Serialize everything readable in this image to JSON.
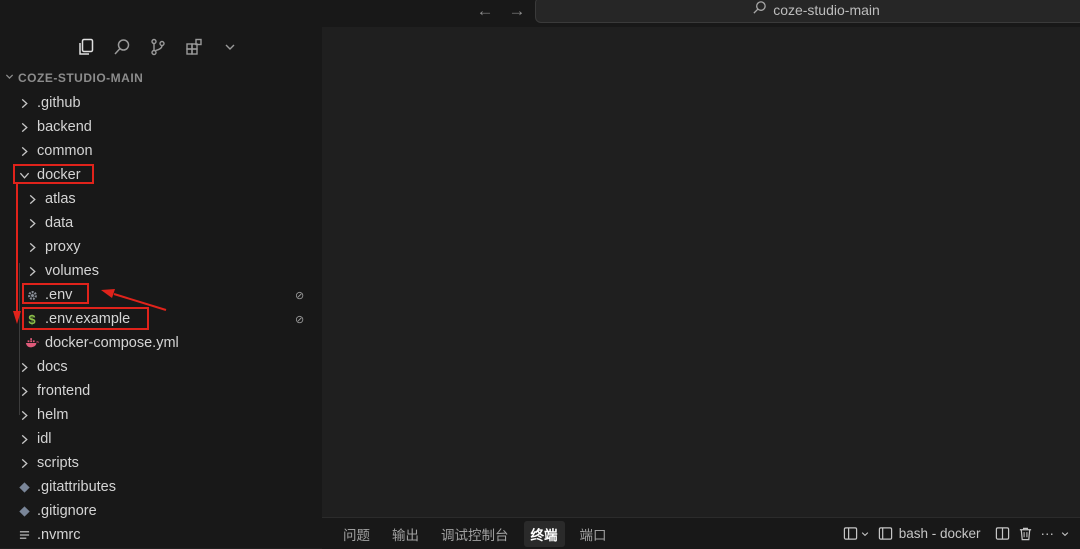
{
  "titlebar": {
    "back_icon": "arrow-left-icon",
    "forward_icon": "arrow-right-icon",
    "search_label": "coze-studio-main"
  },
  "activity_icons": [
    "explorer-icon",
    "search-icon",
    "source-control-icon",
    "extensions-icon",
    "chevron-down-icon"
  ],
  "explorer": {
    "root_label": "COZE-STUDIO-MAIN",
    "items": [
      {
        "label": ".github",
        "type": "folder",
        "expanded": false
      },
      {
        "label": "backend",
        "type": "folder",
        "expanded": false
      },
      {
        "label": "common",
        "type": "folder",
        "expanded": false
      },
      {
        "label": "docker",
        "type": "folder",
        "expanded": true
      },
      {
        "label": "atlas",
        "type": "folder",
        "expanded": false
      },
      {
        "label": "data",
        "type": "folder",
        "expanded": false
      },
      {
        "label": "proxy",
        "type": "folder",
        "expanded": false
      },
      {
        "label": "volumes",
        "type": "folder",
        "expanded": false
      },
      {
        "label": ".env",
        "type": "file",
        "icon": "gear-icon",
        "badge": "⊘"
      },
      {
        "label": ".env.example",
        "type": "file",
        "icon": "dollar-icon",
        "badge": "⊘"
      },
      {
        "label": "docker-compose.yml",
        "type": "file",
        "icon": "docker-whale-icon"
      },
      {
        "label": "docs",
        "type": "folder",
        "expanded": false
      },
      {
        "label": "frontend",
        "type": "folder",
        "expanded": false
      },
      {
        "label": "helm",
        "type": "folder",
        "expanded": false
      },
      {
        "label": "idl",
        "type": "folder",
        "expanded": false
      },
      {
        "label": "scripts",
        "type": "folder",
        "expanded": false
      },
      {
        "label": ".gitattributes",
        "type": "file",
        "icon": "git-icon"
      },
      {
        "label": ".gitignore",
        "type": "file",
        "icon": "git-icon"
      },
      {
        "label": ".nvmrc",
        "type": "file",
        "icon": "lines-icon"
      }
    ]
  },
  "panel": {
    "tabs": [
      "问题",
      "输出",
      "调试控制台",
      "终端",
      "端口"
    ],
    "active_tab": "终端",
    "terminal_name": "bash - docker",
    "right_icons": [
      "terminal-layout-icon",
      "chevron-down-icon",
      "split-terminal-icon",
      "trash-icon",
      "more-icon"
    ],
    "more_label": "···"
  },
  "colors": {
    "annotation_red": "#e0231b",
    "dollar_green": "#8dc149",
    "gear_gray": "#8a8f98",
    "docker_pink": "#e05a7a",
    "git_gray": "#7a8699"
  }
}
